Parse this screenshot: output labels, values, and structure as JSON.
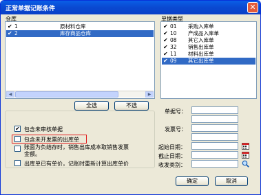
{
  "window": {
    "title": "正常单据记账条件",
    "close_glyph": "✕"
  },
  "warehouse": {
    "header": "仓库",
    "items": [
      {
        "code": "1",
        "name": "原材料仓库",
        "checked": true,
        "selected": false
      },
      {
        "code": "2",
        "name": "库存商品仓库",
        "checked": true,
        "selected": true
      }
    ]
  },
  "doctype": {
    "header": "单据类型",
    "items": [
      {
        "code": "01",
        "name": "采购入库单",
        "checked": true,
        "selected": false
      },
      {
        "code": "10",
        "name": "产成品入库单",
        "checked": true,
        "selected": false
      },
      {
        "code": "08",
        "name": "其它入库单",
        "checked": true,
        "selected": false
      },
      {
        "code": "32",
        "name": "销售出库单",
        "checked": true,
        "selected": false
      },
      {
        "code": "11",
        "name": "材料出库单",
        "checked": true,
        "selected": false
      },
      {
        "code": "09",
        "name": "其它出库单",
        "checked": true,
        "selected": true
      }
    ]
  },
  "buttons": {
    "select_all": "全选",
    "deselect": "不选",
    "ok": "确定",
    "cancel": "取消"
  },
  "options": [
    {
      "label": "包含未审核单据",
      "checked": true
    },
    {
      "label": "包含未开发票的出库单",
      "checked": false,
      "highlighted": true
    },
    {
      "label": "账面为负结存时，销售出库成本取销售发票\n金额。",
      "checked": false
    },
    {
      "label": "出库单已有单价，记账时重新计算出库单价",
      "checked": false
    }
  ],
  "fields": {
    "doc_no": {
      "label": "单据号：",
      "value": ""
    },
    "invoice_no": {
      "label": "发票号：",
      "value": ""
    },
    "start_date": {
      "label": "起始日期：",
      "value": ""
    },
    "end_date": {
      "label": "截止日期：",
      "value": ""
    },
    "recv_type": {
      "label": "收发类别：",
      "value": ""
    }
  },
  "icons": {
    "calendar": "calendar-icon",
    "search": "search-icon",
    "check_glyph": "✔"
  },
  "colors": {
    "title_bar": "#0a49d1",
    "selection": "#316ac5",
    "highlight_box": "#e01818"
  }
}
